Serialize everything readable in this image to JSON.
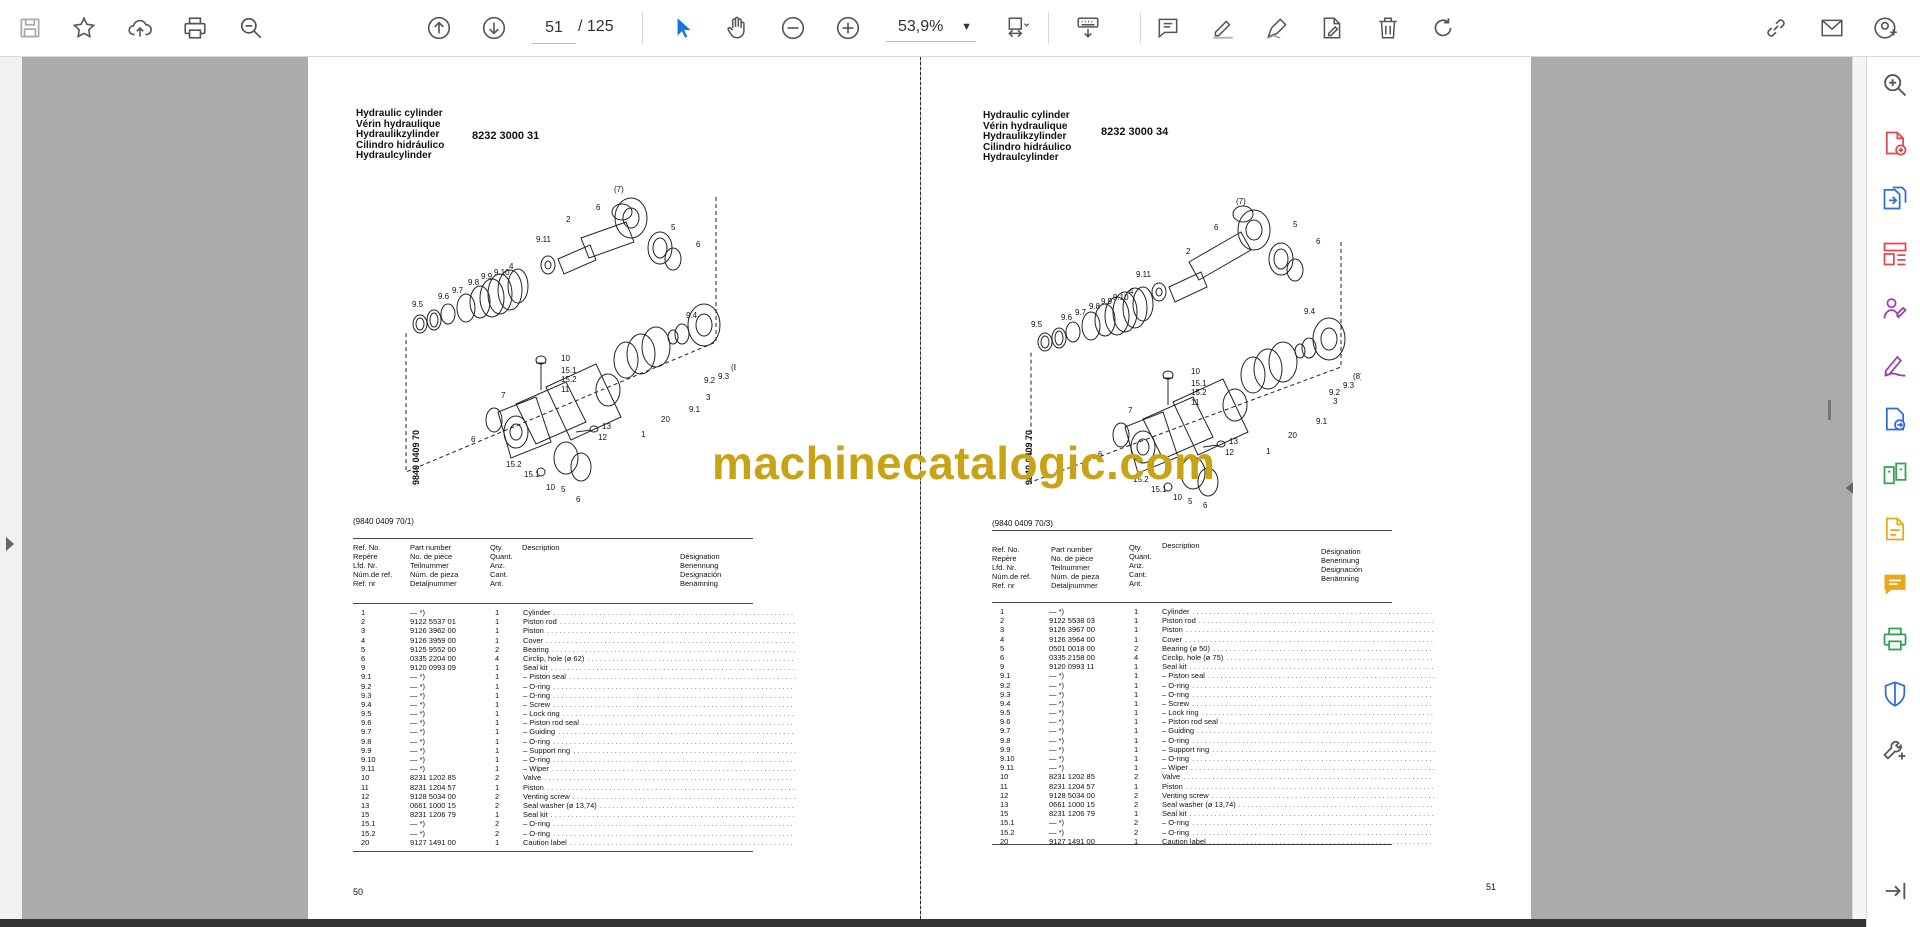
{
  "toolbar": {
    "current_page": "51",
    "page_separator": "/",
    "total_pages": "125",
    "zoom": "53,9%",
    "zoom_caret": "▼"
  },
  "left_page": {
    "title_lines": [
      "Hydraulic cylinder",
      "Vérin hydraulique",
      "Hydraulikzylinder",
      "Cilindro hidráulico",
      "Hydraulcylinder"
    ],
    "part_code": "8232 3000 31",
    "vertical_code": "9840 0409 70",
    "ref_code": "(9840 0409 70/1)",
    "headers": {
      "ref": [
        "Ref. No.",
        "Repère",
        "Lfd. Nr.",
        "Núm.de ref.",
        "Ref. nr"
      ],
      "part": [
        "Part number",
        "No. de pièce",
        "Teilnummer",
        "Núm. de pieza",
        "Detaljnummer"
      ],
      "qty": [
        "Qty.",
        "Quant.",
        "Anz.",
        "Cant.",
        "Ant."
      ],
      "desc": [
        "Description"
      ],
      "desig": [
        "Désignation",
        "Benennung",
        "Designación",
        "Benämning"
      ]
    },
    "rows": [
      {
        "ref": "1",
        "part": "—      *)",
        "qty": "1",
        "desc": "Cylinder"
      },
      {
        "ref": "2",
        "part": "9122 5537 01",
        "qty": "1",
        "desc": "Piston rod"
      },
      {
        "ref": "3",
        "part": "9126 3962 00",
        "qty": "1",
        "desc": "Piston"
      },
      {
        "ref": "4",
        "part": "9126 3959 00",
        "qty": "1",
        "desc": "Cover"
      },
      {
        "ref": "5",
        "part": "9125 9552 00",
        "qty": "2",
        "desc": "Bearing"
      },
      {
        "ref": "6",
        "part": "0335 2204 00",
        "qty": "4",
        "desc": "Circlip, hole (ø 62)"
      },
      {
        "ref": "9",
        "part": "9120 0993 09",
        "qty": "1",
        "desc": "Seal kit"
      },
      {
        "ref": "9.1",
        "part": "—      *)",
        "qty": "1",
        "desc": "– Piston seal"
      },
      {
        "ref": "9.2",
        "part": "—      *)",
        "qty": "1",
        "desc": "– O-ring"
      },
      {
        "ref": "9.3",
        "part": "—      *)",
        "qty": "1",
        "desc": "– O-ring"
      },
      {
        "ref": "9.4",
        "part": "—      *)",
        "qty": "1",
        "desc": "– Screw"
      },
      {
        "ref": "9.5",
        "part": "—      *)",
        "qty": "1",
        "desc": "– Lock ring"
      },
      {
        "ref": "9.6",
        "part": "—      *)",
        "qty": "1",
        "desc": "– Piston rod seal"
      },
      {
        "ref": "9.7",
        "part": "—      *)",
        "qty": "1",
        "desc": "– Guiding"
      },
      {
        "ref": "9.8",
        "part": "—      *)",
        "qty": "1",
        "desc": "– O-ring"
      },
      {
        "ref": "9.9",
        "part": "—      *)",
        "qty": "1",
        "desc": "– Support ring"
      },
      {
        "ref": "9.10",
        "part": "—      *)",
        "qty": "1",
        "desc": "– O-ring"
      },
      {
        "ref": "9.11",
        "part": "—      *)",
        "qty": "1",
        "desc": "– Wiper"
      },
      {
        "ref": "10",
        "part": "8231 1202 85",
        "qty": "2",
        "desc": "Valve"
      },
      {
        "ref": "11",
        "part": "8231 1204 57",
        "qty": "1",
        "desc": "Piston"
      },
      {
        "ref": "12",
        "part": "9128 5034 00",
        "qty": "2",
        "desc": "Venting screw"
      },
      {
        "ref": "13",
        "part": "0661 1000 15",
        "qty": "2",
        "desc": "Seal washer (ø 13,74)"
      },
      {
        "ref": "15",
        "part": "8231 1206 79",
        "qty": "1",
        "desc": "Seal kit"
      },
      {
        "ref": "15.1",
        "part": "—      *)",
        "qty": "2",
        "desc": "– O-ring"
      },
      {
        "ref": "15.2",
        "part": "—      *)",
        "qty": "2",
        "desc": "– O-ring"
      },
      {
        "ref": "20",
        "part": "9127 1491 00",
        "qty": "1",
        "desc": "Caution label"
      }
    ],
    "page_number": "50"
  },
  "right_page": {
    "title_lines": [
      "Hydraulic cylinder",
      "Vérin hydraulique",
      "Hydraulikzylinder",
      "Cilindro hidráulico",
      "Hydraulcylinder"
    ],
    "part_code": "8232 3000 34",
    "vertical_code": "9840 0409 70",
    "ref_code": "(9840 0409 70/3)",
    "headers": {
      "ref": [
        "Ref. No.",
        "Repère",
        "Lfd. Nr.",
        "Núm.de ref.",
        "Ref. nr"
      ],
      "part": [
        "Part number",
        "No. de pièce",
        "Teilnummer",
        "Núm. de pieza",
        "Detaljnummer"
      ],
      "qty": [
        "Qty.",
        "Quant.",
        "Anz.",
        "Cant.",
        "Ant."
      ],
      "desc": [
        "Description"
      ],
      "desig": [
        "Désignation",
        "Benennung",
        "Designación",
        "Benämning"
      ]
    },
    "rows": [
      {
        "ref": "1",
        "part": "—      *)",
        "qty": "1",
        "desc": "Cylinder"
      },
      {
        "ref": "2",
        "part": "9122 5538 03",
        "qty": "1",
        "desc": "Piston rod"
      },
      {
        "ref": "3",
        "part": "9126 3967 00",
        "qty": "1",
        "desc": "Piston"
      },
      {
        "ref": "4",
        "part": "9126 3964 00",
        "qty": "1",
        "desc": "Cover"
      },
      {
        "ref": "5",
        "part": "0501 0018 00",
        "qty": "2",
        "desc": "Bearing (ø 50)"
      },
      {
        "ref": "6",
        "part": "0335 2158 00",
        "qty": "4",
        "desc": "Circlip, hole (ø 75)"
      },
      {
        "ref": "9",
        "part": "9120 0993 11",
        "qty": "1",
        "desc": "Seal kit"
      },
      {
        "ref": "9.1",
        "part": "—      *)",
        "qty": "1",
        "desc": "– Piston seal"
      },
      {
        "ref": "9.2",
        "part": "—      *)",
        "qty": "1",
        "desc": "– O-ring"
      },
      {
        "ref": "9.3",
        "part": "—      *)",
        "qty": "1",
        "desc": "– O-ring"
      },
      {
        "ref": "9.4",
        "part": "—      *)",
        "qty": "1",
        "desc": "– Screw"
      },
      {
        "ref": "9.5",
        "part": "—      *)",
        "qty": "1",
        "desc": "– Lock ring"
      },
      {
        "ref": "9.6",
        "part": "—      *)",
        "qty": "1",
        "desc": "– Piston rod seal"
      },
      {
        "ref": "9.7",
        "part": "—      *)",
        "qty": "1",
        "desc": "– Guiding"
      },
      {
        "ref": "9.8",
        "part": "—      *)",
        "qty": "1",
        "desc": "– O-ring"
      },
      {
        "ref": "9.9",
        "part": "—      *)",
        "qty": "1",
        "desc": "– Support ring"
      },
      {
        "ref": "9.10",
        "part": "—      *)",
        "qty": "1",
        "desc": "– O-ring"
      },
      {
        "ref": "9.11",
        "part": "—      *)",
        "qty": "1",
        "desc": "– Wiper"
      },
      {
        "ref": "10",
        "part": "8231 1202 85",
        "qty": "2",
        "desc": "Valve"
      },
      {
        "ref": "11",
        "part": "8231 1204 57",
        "qty": "1",
        "desc": "Piston"
      },
      {
        "ref": "12",
        "part": "9128 5034 00",
        "qty": "2",
        "desc": "Venting screw"
      },
      {
        "ref": "13",
        "part": "0661 1000 15",
        "qty": "2",
        "desc": "Seal washer (ø 13,74)"
      },
      {
        "ref": "15",
        "part": "8231 1206 79",
        "qty": "1",
        "desc": "Seal kit"
      },
      {
        "ref": "15.1",
        "part": "—      *)",
        "qty": "2",
        "desc": "– O-ring"
      },
      {
        "ref": "15.2",
        "part": "—      *)",
        "qty": "2",
        "desc": "– O-ring"
      },
      {
        "ref": "20",
        "part": "9127 1491 00",
        "qty": "1",
        "desc": "Caution label"
      }
    ],
    "page_number": "51"
  },
  "diagram_labels": [
    "(7)",
    "6",
    "5",
    "6",
    "2",
    "9.11",
    "4",
    "9.10",
    "9.9",
    "9.8",
    "9.7",
    "9.6",
    "9.5",
    "9.4",
    "10",
    "15.1",
    "15.2",
    "11",
    "7",
    "1",
    "20",
    "9.1",
    "3",
    "9.2",
    "9.3",
    "(8)",
    "13",
    "12",
    "6",
    "15.2",
    "15.1",
    "10",
    "5",
    "6"
  ],
  "watermark": "machinecatalogic.com",
  "colors": {
    "accent": "#1473e6",
    "viewer_bg": "#ababab",
    "watermark": "#c9a316"
  }
}
